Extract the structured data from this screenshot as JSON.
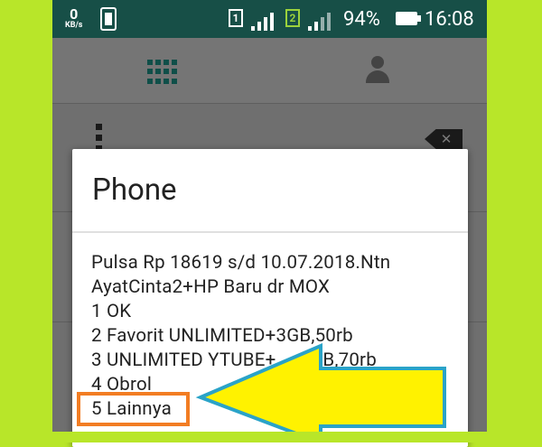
{
  "status_bar": {
    "data_speed_value": "0",
    "data_speed_unit": "KB/s",
    "sim1_label": "1",
    "sim2_label": "2",
    "battery_percent": "94%",
    "time": "16:08"
  },
  "tabs": [
    {
      "icon": "dialpad-icon"
    },
    {
      "icon": "contacts-icon"
    }
  ],
  "dialog": {
    "title": "Phone",
    "message_lines": [
      "Pulsa Rp 18619 s/d 10.07.2018.Ntn",
      "AyatCinta2+HP Baru dr MOX",
      "1 OK",
      "2 Favorit UNLIMITED+3GB,50rb",
      "3 UNLIMITED YTUBE+",
      "4 Obrol",
      "5 Lainnya"
    ],
    "line3_tail": "B,70rb"
  },
  "annotation": {
    "arrow_color": "#fff200",
    "arrow_outline": "#2aa3c8",
    "box_color": "#f27d23",
    "frame_color": "#b8e629"
  }
}
